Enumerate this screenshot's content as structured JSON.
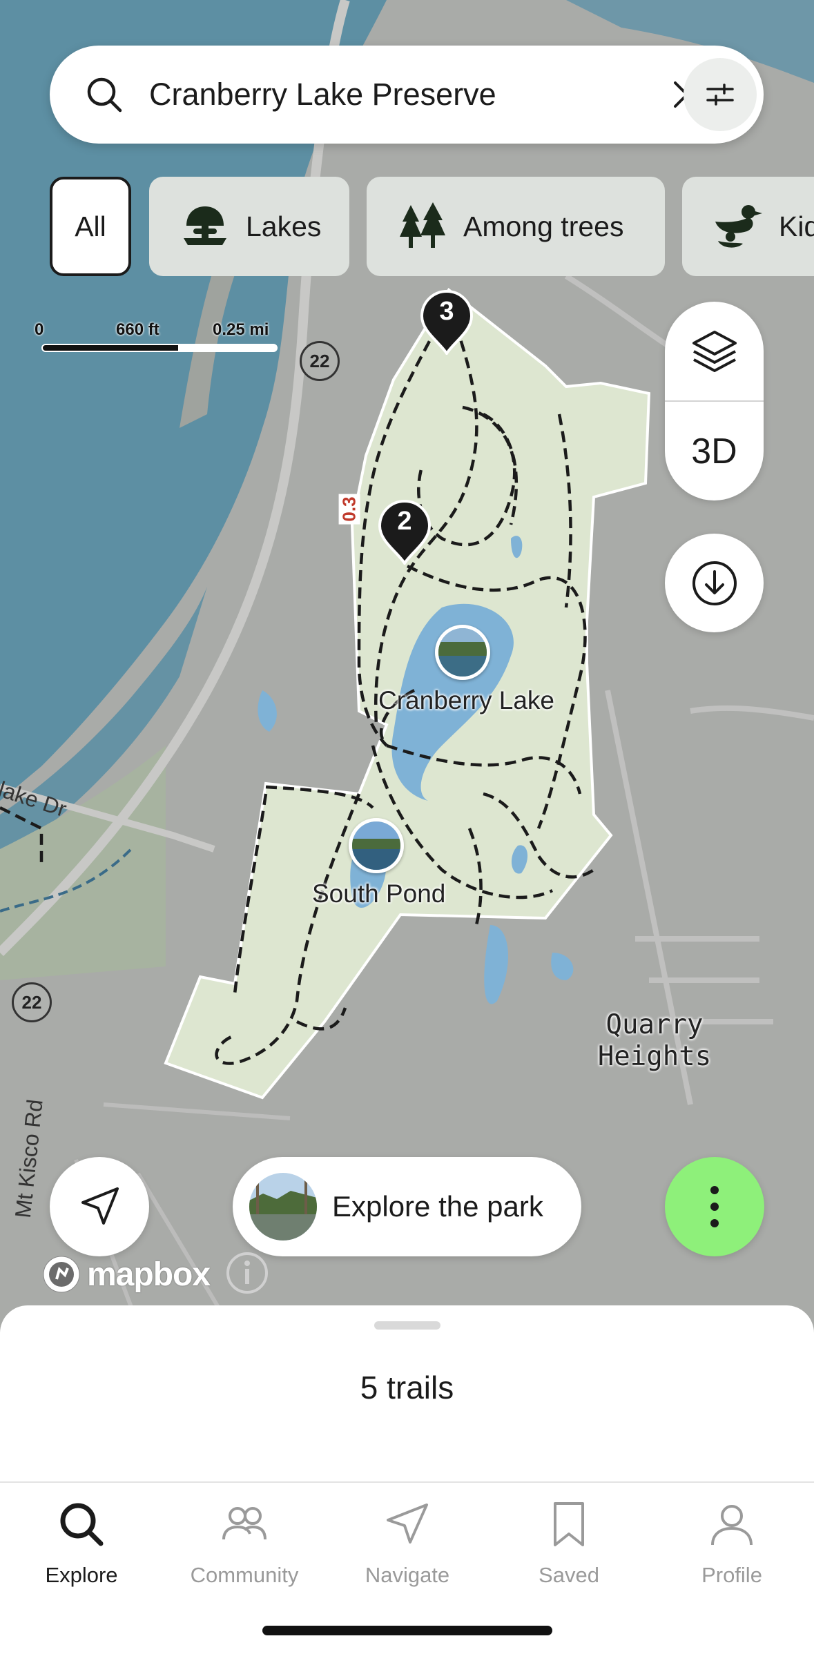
{
  "search": {
    "query": "Cranberry Lake Preserve"
  },
  "categories": [
    {
      "label": "All",
      "selected": true
    },
    {
      "label": "Lakes",
      "icon": "lake-icon"
    },
    {
      "label": "Among trees",
      "icon": "trees-icon"
    },
    {
      "label": "Kids",
      "icon": "kids-icon"
    }
  ],
  "scale": {
    "zero": "0",
    "feet": "660 ft",
    "miles": "0.25 mi"
  },
  "controls": {
    "three_d": "3D"
  },
  "map": {
    "pins": [
      {
        "label": "3"
      },
      {
        "label": "2"
      }
    ],
    "places": [
      {
        "label": "Cranberry Lake"
      },
      {
        "label": "South Pond"
      },
      {
        "label": "Quarry Heights"
      }
    ],
    "roads": [
      {
        "label": "tlake Dr"
      },
      {
        "label": "Mt Kisco Rd"
      }
    ],
    "route_shields": [
      "22",
      "22"
    ],
    "distance_label": "0.3"
  },
  "explore": {
    "label": "Explore the park"
  },
  "attribution": {
    "brand": "mapbox"
  },
  "sheet": {
    "trail_count": "5 trails"
  },
  "tabs": [
    {
      "label": "Explore",
      "icon": "search-icon",
      "active": true
    },
    {
      "label": "Community",
      "icon": "community-icon"
    },
    {
      "label": "Navigate",
      "icon": "navigate-icon"
    },
    {
      "label": "Saved",
      "icon": "bookmark-icon"
    },
    {
      "label": "Profile",
      "icon": "profile-icon"
    }
  ],
  "colors": {
    "water": "#5d8fa3",
    "park": "#dde6d0",
    "land": "#a9aba8",
    "accent_green": "#8ef07a",
    "trail": "#1b1b1b"
  }
}
